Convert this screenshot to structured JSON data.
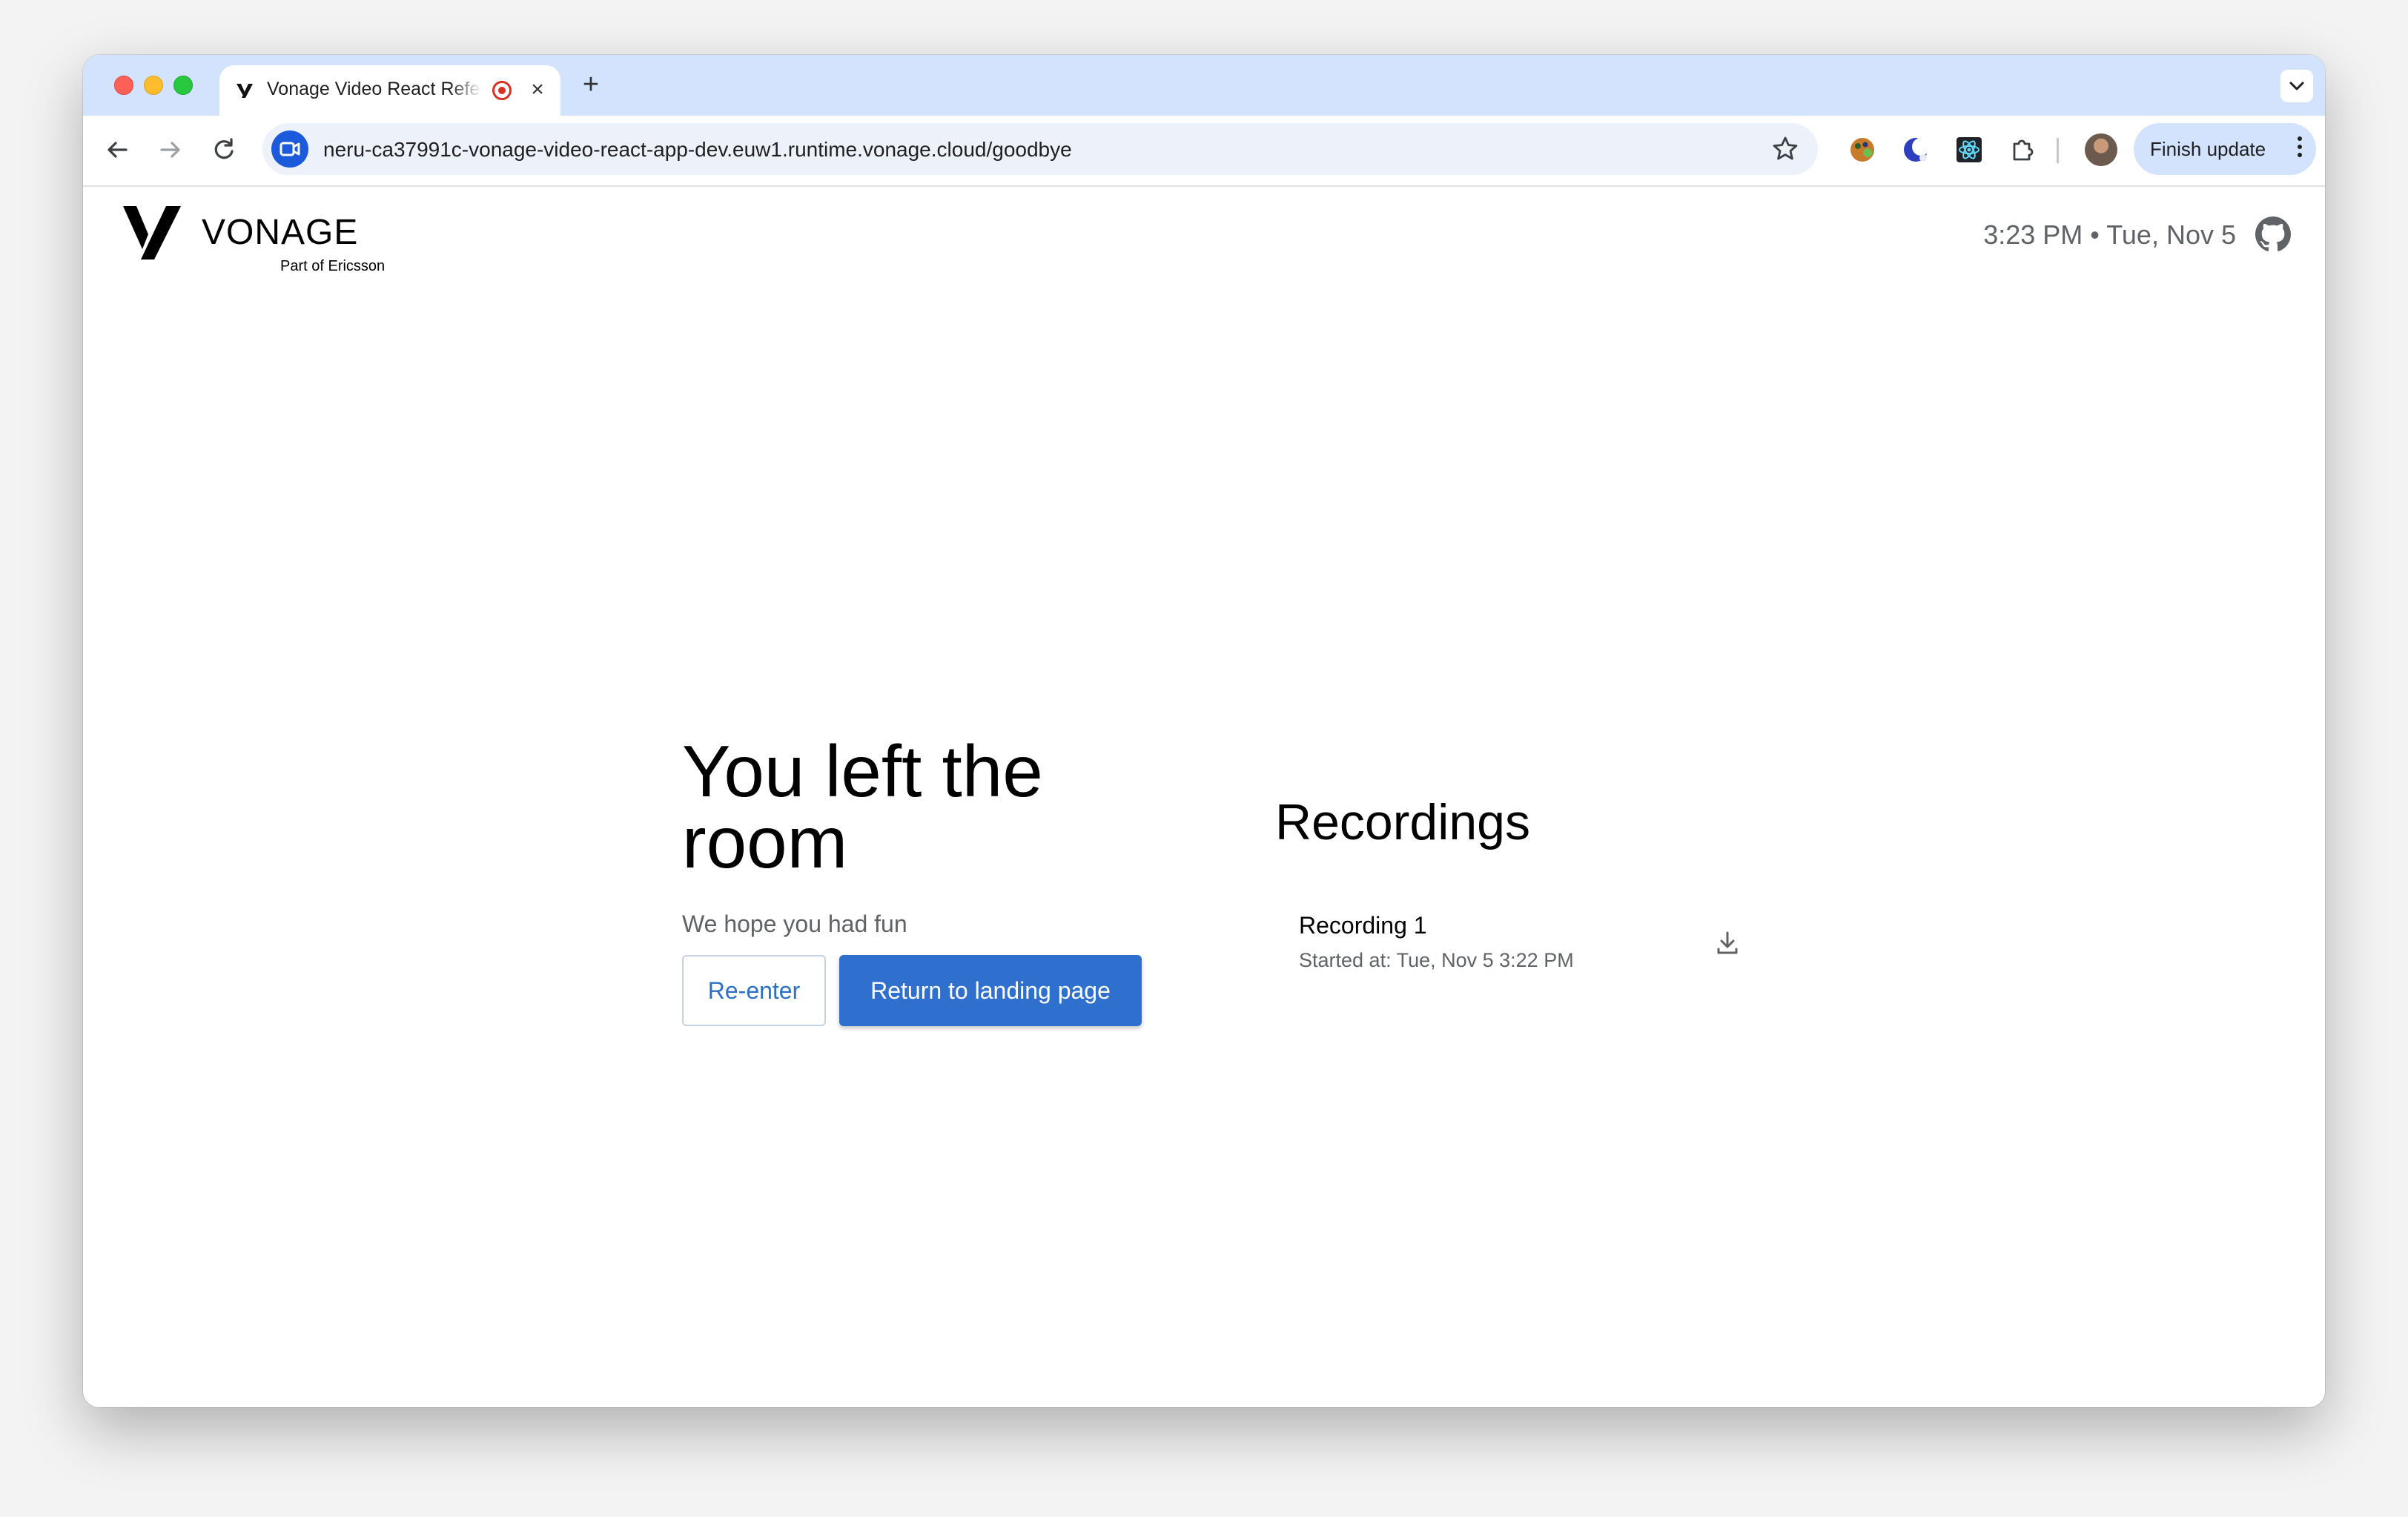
{
  "browser": {
    "tab_title": "Vonage Video React Refer",
    "url": "neru-ca37991c-vonage-video-react-app-dev.euw1.runtime.vonage.cloud/goodbye",
    "finish_update_label": "Finish update"
  },
  "header": {
    "logo_word": "VONAGE",
    "logo_sub": "Part of Ericsson",
    "clock": "3:23 PM • Tue, Nov 5"
  },
  "goodbye": {
    "title": "You left the room",
    "subtitle": "We hope you had fun",
    "reenter_label": "Re-enter",
    "return_label": "Return to landing page"
  },
  "recordings": {
    "title": "Recordings",
    "items": [
      {
        "name": "Recording 1",
        "started": "Started at: Tue, Nov 5 3:22 PM"
      }
    ]
  },
  "colors": {
    "primary": "#2f70cf",
    "tabstrip": "#d3e3fd",
    "record": "#d93025"
  }
}
